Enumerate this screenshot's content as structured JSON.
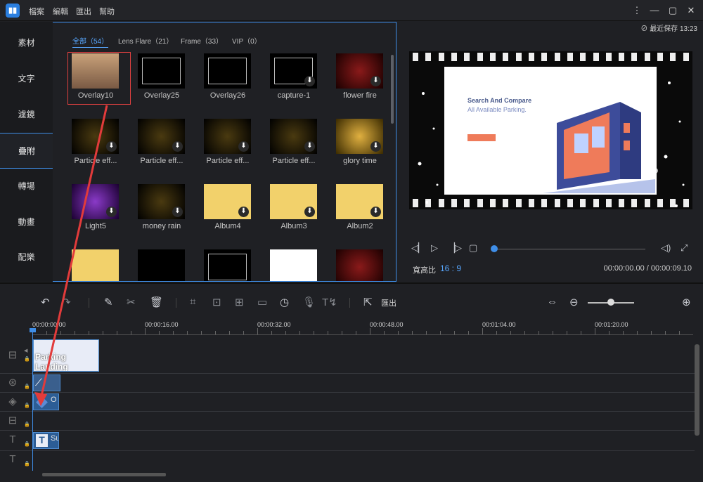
{
  "menu": [
    "檔案",
    "編輯",
    "匯出",
    "幫助"
  ],
  "window": {
    "more": "⋮",
    "min": "—",
    "max": "▢",
    "close": "✕"
  },
  "autosave": "最近保存 13:23",
  "side_tabs": [
    "素材",
    "文字",
    "濾鏡",
    "疊附",
    "轉場",
    "動畫",
    "配樂"
  ],
  "lib_tabs": [
    "全部（54）",
    "Lens Flare（21）",
    "Frame（33）",
    "VIP（0）"
  ],
  "items": [
    {
      "label": "Overlay10",
      "icon": "photo-thumb",
      "download": false
    },
    {
      "label": "Overlay25",
      "icon": "frame-thumb",
      "download": false
    },
    {
      "label": "Overlay26",
      "icon": "frame-thumb",
      "download": false
    },
    {
      "label": "capture-1",
      "icon": "frame-thumb",
      "download": true
    },
    {
      "label": "flower fire",
      "icon": "sparkle-thumb",
      "download": true
    },
    {
      "label": "Particle eff...",
      "icon": "particle-thumb",
      "download": true
    },
    {
      "label": "Particle eff...",
      "icon": "particle-thumb",
      "download": true
    },
    {
      "label": "Particle eff...",
      "icon": "particle-thumb",
      "download": true
    },
    {
      "label": "Particle eff...",
      "icon": "particle-thumb",
      "download": true
    },
    {
      "label": "glory time",
      "icon": "bokeh-thumb",
      "download": true
    },
    {
      "label": "Light5",
      "icon": "light-thumb",
      "download": true
    },
    {
      "label": "money rain",
      "icon": "particle-thumb",
      "download": true
    },
    {
      "label": "Album4",
      "icon": "album-thumb",
      "download": true
    },
    {
      "label": "Album3",
      "icon": "album-thumb",
      "download": true
    },
    {
      "label": "Album2",
      "icon": "album-thumb",
      "download": true
    },
    {
      "label": "",
      "icon": "album-thumb",
      "download": false
    },
    {
      "label": "",
      "icon": "cloud-thumb",
      "download": false
    },
    {
      "label": "",
      "icon": "frame-thumb",
      "download": false
    },
    {
      "label": "",
      "icon": "splatter-thumb",
      "download": false
    },
    {
      "label": "",
      "icon": "sparkle-thumb",
      "download": false
    }
  ],
  "download_glyph": "⬇",
  "preview": {
    "title": "Search And Compare",
    "subtitle": "All Available Parking."
  },
  "controls": {
    "ratio_label": "寬高比",
    "ratio": "16 : 9",
    "time": "00:00:00.00 / 00:00:09.10",
    "progress": 0
  },
  "toolbar": {
    "export_label": "匯出"
  },
  "ruler": [
    "00:00:00.00",
    "00:00:16.00",
    "00:00:32.00",
    "00:00:48.00",
    "00:01:04.00",
    "00:01:20.00"
  ],
  "clips": {
    "video": "Parking Landing",
    "overlay": "O",
    "text": "Su"
  }
}
